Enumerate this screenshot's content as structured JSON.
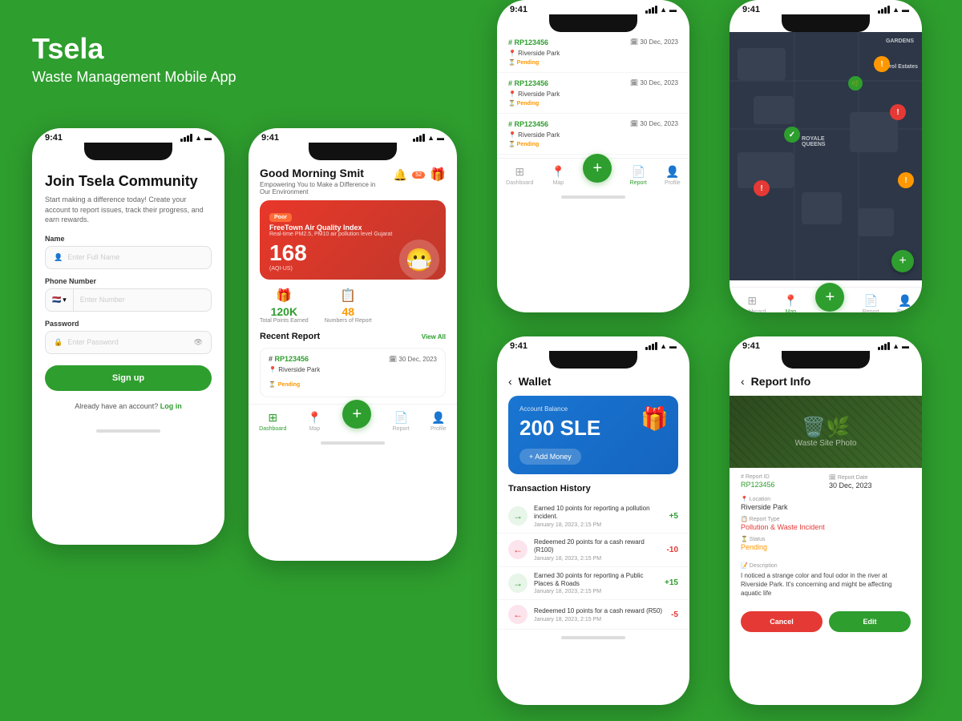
{
  "app": {
    "title": "Tsela",
    "subtitle": "Waste Management Mobile App"
  },
  "phone_signup": {
    "title": "Join Tsela Community",
    "description": "Start making a difference today! Create your account to report issues, track their progress, and earn rewards.",
    "name_label": "Name",
    "name_placeholder": "Enter Full Name",
    "phone_label": "Phone Number",
    "flag": "🇳🇱",
    "phone_placeholder": "Enter Number",
    "password_label": "Password",
    "password_placeholder": "Enter Password",
    "signup_btn": "Sign up",
    "login_text": "Already have an account?",
    "login_link": "Log in"
  },
  "phone_dashboard": {
    "time": "9:41",
    "greeting": "Good Morning Smit",
    "sub_greeting": "Empowering You to Make a Difference in\nOur Environment",
    "air_quality": {
      "badge": "Poor",
      "title": "FreeTown Air Quality Index",
      "subtitle": "Real-time PM2.5, PM10 air pollution level Gujarat",
      "value": "168",
      "unit": "(AQI-US)"
    },
    "stats": {
      "points": "120K",
      "points_label": "Total Points Earned",
      "reports": "48",
      "reports_label": "Numbers of Report"
    },
    "recent_report": {
      "section_title": "Recent Report",
      "view_all": "View All",
      "id": "RP123456",
      "date": "30 Dec, 2023",
      "location": "Riverside Park",
      "status": "Pending"
    },
    "nav": {
      "dashboard": "Dashboard",
      "map": "Map",
      "report": "Report",
      "profile": "Profile"
    }
  },
  "phone_reports": {
    "time": "9:41",
    "reports": [
      {
        "id": "RP123456",
        "date": "30 Dec, 2023",
        "location": "Riverside Park",
        "status": "Pending"
      },
      {
        "id": "RP123456",
        "date": "30 Dec, 2023",
        "location": "Riverside Park",
        "status": "Pending"
      },
      {
        "id": "RP123456",
        "date": "30 Dec, 2023",
        "location": "Riverside Park",
        "status": "Pending"
      }
    ]
  },
  "phone_map": {
    "time": "9:41",
    "labels": [
      "GARDENS",
      "Tyrol Estates",
      "ROYALE QUEENS"
    ],
    "nav": {
      "dashboard": "Dashboard",
      "map": "Map",
      "report": "Report",
      "profile": "Profile"
    }
  },
  "phone_wallet": {
    "time": "9:41",
    "title": "Wallet",
    "balance_label": "Account Balance",
    "balance": "200 SLE",
    "add_money": "+ Add Money",
    "transaction_title": "Transaction History",
    "transactions": [
      {
        "type": "plus",
        "desc": "Earned 10 points for reporting a pollution incident.",
        "date": "January 18, 2023, 2:15 PM",
        "amount": "+5"
      },
      {
        "type": "minus",
        "desc": "Redeemed 20 points for a cash reward (R100)",
        "date": "January 18, 2023, 2:15 PM",
        "amount": "-10"
      },
      {
        "type": "plus",
        "desc": "Earned 30 points for reporting a Public Places & Roads",
        "date": "January 18, 2023, 2:15 PM",
        "amount": "+15"
      },
      {
        "type": "minus",
        "desc": "Redeemed 10 points for a cash reward (R50)",
        "date": "January 18, 2023, 2:15 PM",
        "amount": "-5"
      }
    ]
  },
  "phone_report_info": {
    "time": "9:41",
    "title": "Report Info",
    "report_id_label": "Report ID",
    "report_id": "RP123456",
    "report_date_label": "Report Date",
    "report_date": "30 Dec, 2023",
    "location_label": "Location",
    "location": "Riverside Park",
    "report_type_label": "Report Type",
    "report_type": "Pollution & Waste Incident",
    "status_label": "Status",
    "status": "Pending",
    "description_label": "Description",
    "description": "I noticed a strange color and foul odor in the river at Riverside Park. It's concerning and might be affecting aquatic life",
    "cancel_btn": "Cancel",
    "edit_btn": "Edit"
  }
}
